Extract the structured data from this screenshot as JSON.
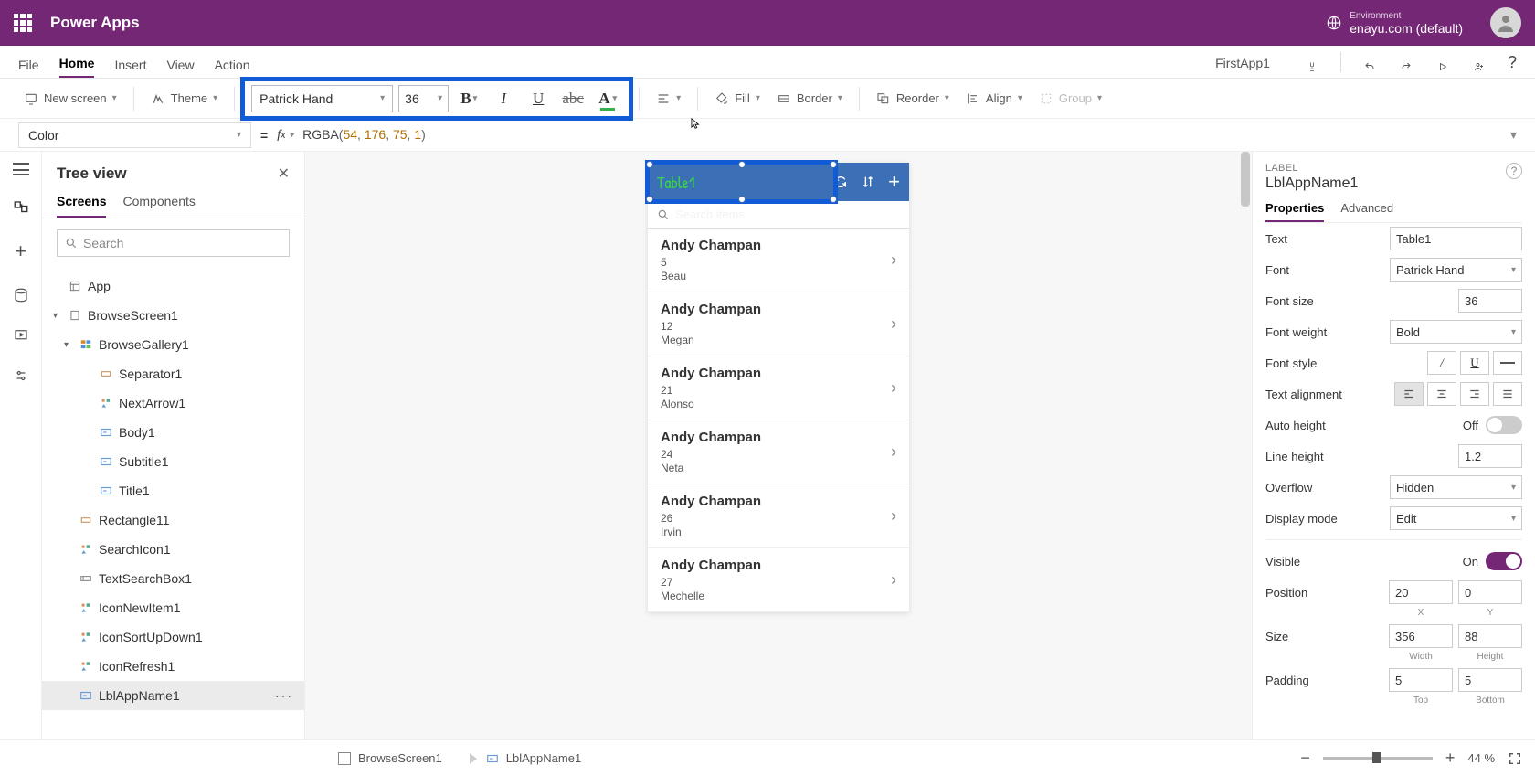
{
  "topbar": {
    "title": "Power Apps",
    "env_label": "Environment",
    "env_value": "enayu.com (default)"
  },
  "menu": {
    "items": [
      "File",
      "Home",
      "Insert",
      "View",
      "Action"
    ],
    "active": "Home",
    "app_name": "FirstApp1"
  },
  "toolbar": {
    "new_screen": "New screen",
    "theme": "Theme",
    "font": "Patrick Hand",
    "font_size": "36",
    "fill": "Fill",
    "border": "Border",
    "reorder": "Reorder",
    "align": "Align",
    "group": "Group"
  },
  "formula": {
    "property": "Color",
    "rgba_fn": "RGBA",
    "a": "54",
    "b": "176",
    "c": "75",
    "d": "1"
  },
  "tree": {
    "title": "Tree view",
    "tabs": [
      "Screens",
      "Components"
    ],
    "search_placeholder": "Search",
    "app": "App",
    "screen": "BrowseScreen1",
    "gallery": "BrowseGallery1",
    "items": [
      "Separator1",
      "NextArrow1",
      "Body1",
      "Subtitle1",
      "Title1"
    ],
    "rest": [
      "Rectangle11",
      "SearchIcon1",
      "TextSearchBox1",
      "IconNewItem1",
      "IconSortUpDown1",
      "IconRefresh1",
      "LblAppName1"
    ]
  },
  "phone": {
    "title": "Table1",
    "search_placeholder": "Search items",
    "rows": [
      {
        "title": "Andy Champan",
        "n": "5",
        "sub": "Beau"
      },
      {
        "title": "Andy Champan",
        "n": "12",
        "sub": "Megan"
      },
      {
        "title": "Andy Champan",
        "n": "21",
        "sub": "Alonso"
      },
      {
        "title": "Andy Champan",
        "n": "24",
        "sub": "Neta"
      },
      {
        "title": "Andy Champan",
        "n": "26",
        "sub": "Irvin"
      },
      {
        "title": "Andy Champan",
        "n": "27",
        "sub": "Mechelle"
      }
    ]
  },
  "props": {
    "category": "LABEL",
    "name": "LblAppName1",
    "tabs": [
      "Properties",
      "Advanced"
    ],
    "text_lbl": "Text",
    "text_val": "Table1",
    "font_lbl": "Font",
    "font_val": "Patrick Hand",
    "size_lbl": "Font size",
    "size_val": "36",
    "weight_lbl": "Font weight",
    "weight_val": "Bold",
    "style_lbl": "Font style",
    "align_lbl": "Text alignment",
    "auto_lbl": "Auto height",
    "auto_val": "Off",
    "line_lbl": "Line height",
    "line_val": "1.2",
    "over_lbl": "Overflow",
    "over_val": "Hidden",
    "mode_lbl": "Display mode",
    "mode_val": "Edit",
    "vis_lbl": "Visible",
    "vis_val": "On",
    "pos_lbl": "Position",
    "pos_x": "20",
    "pos_y": "0",
    "pos_xl": "X",
    "pos_yl": "Y",
    "sz_lbl": "Size",
    "sz_w": "356",
    "sz_h": "88",
    "sz_wl": "Width",
    "sz_hl": "Height",
    "pad_lbl": "Padding",
    "pad_t": "5",
    "pad_b": "5",
    "pad_tl": "Top",
    "pad_bl": "Bottom"
  },
  "status": {
    "crumb1": "BrowseScreen1",
    "crumb2": "LblAppName1",
    "zoom": "44",
    "pct": "%"
  }
}
